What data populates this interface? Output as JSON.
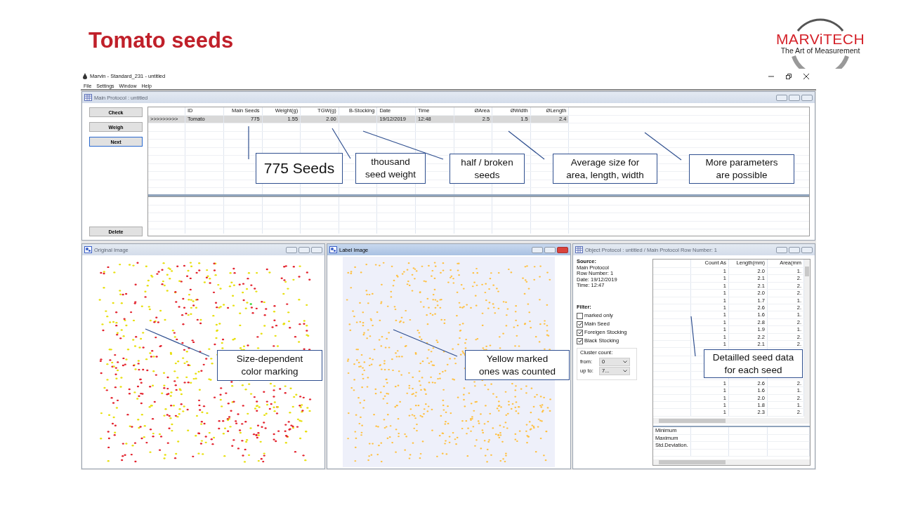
{
  "slide": {
    "title": "Tomato seeds"
  },
  "logo": {
    "name": "MARViTECH",
    "tagline": "The Art of Measurement"
  },
  "window": {
    "title": "Marvin - Standard_231 - untitled"
  },
  "menu": [
    "File",
    "Settings",
    "Window",
    "Help"
  ],
  "main_protocol": {
    "title": "Main Protocol : untitled",
    "active": false,
    "buttons": [
      {
        "label": "Check",
        "focused": false
      },
      {
        "label": "Weigh",
        "focused": false
      },
      {
        "label": "Next",
        "focused": true
      }
    ],
    "delete_button": "Delete",
    "columns": [
      "ID",
      "Main Seeds",
      "Weight(g)",
      "TGW(g)",
      "B-Stocking",
      "Date",
      "Time",
      "ØArea",
      "ØWidth",
      "ØLength"
    ],
    "rows": [
      {
        "selected": true,
        "marker": ">>>>>>>>>",
        "cells": [
          "Tomato",
          "775",
          "1.55",
          "2.00",
          null,
          "19/12/2019",
          "12:48",
          "2.5",
          "1.5",
          "2.4"
        ]
      }
    ]
  },
  "original_image": {
    "title": "Original Image",
    "active": false
  },
  "label_image": {
    "title": "Label Image",
    "active": true
  },
  "object_protocol": {
    "title": "Object Protocol : untitled / Main Protocol Row Number: 1",
    "active": false,
    "source_heading": "Source:",
    "source_lines": [
      "Main Protocol",
      "Row Number: 1",
      "Date: 19/12/2019",
      "Time: 12:47"
    ],
    "filter_heading": "Filter:",
    "filters": [
      {
        "label": "marked only",
        "checked": false
      },
      {
        "label": "Main Seed",
        "checked": true
      },
      {
        "label": "Foreigen Stocking",
        "checked": true
      },
      {
        "label": "Black Stocking",
        "checked": true
      }
    ],
    "cluster_legend": "Cluster count:",
    "cluster_fields": [
      {
        "label": "from:",
        "value": "0"
      },
      {
        "label": "up to:",
        "value": "7..."
      }
    ],
    "columns": [
      "Count As",
      "Length(mm)",
      "Area(mm"
    ],
    "rows": [
      {
        "count_as": "1",
        "length": "2.0",
        "area": "1."
      },
      {
        "count_as": "1",
        "length": "2.1",
        "area": "2."
      },
      {
        "count_as": "1",
        "length": "2.1",
        "area": "2."
      },
      {
        "count_as": "1",
        "length": "2.0",
        "area": "2."
      },
      {
        "count_as": "1",
        "length": "1.7",
        "area": "1."
      },
      {
        "count_as": "1",
        "length": "2.6",
        "area": "2."
      },
      {
        "count_as": "1",
        "length": "1.6",
        "area": "1."
      },
      {
        "count_as": "1",
        "length": "2.8",
        "area": "2."
      },
      {
        "count_as": "1",
        "length": "1.9",
        "area": "1."
      },
      {
        "count_as": "1",
        "length": "2.2",
        "area": "2."
      },
      {
        "count_as": "1",
        "length": "2.1",
        "area": "2."
      },
      {
        "count_as": "1",
        "length": "2.6",
        "area": "2."
      },
      {
        "count_as": "1",
        "length": "1.6",
        "area": "1."
      },
      {
        "count_as": "1",
        "length": "2.0",
        "area": "2."
      },
      {
        "count_as": "1",
        "length": "1.8",
        "area": "1."
      },
      {
        "count_as": "1",
        "length": "2.3",
        "area": "2."
      }
    ],
    "summary": [
      "Minimum",
      "Maximum",
      "Std.Deviation."
    ]
  },
  "callouts": [
    "775 Seeds",
    "thousand seed weight",
    "half / broken seeds",
    "Average size for area, length, width",
    "More parameters are possible",
    "Size-dependent color marking",
    "Yellow marked ones was counted",
    "Detailled seed data for each seed"
  ]
}
